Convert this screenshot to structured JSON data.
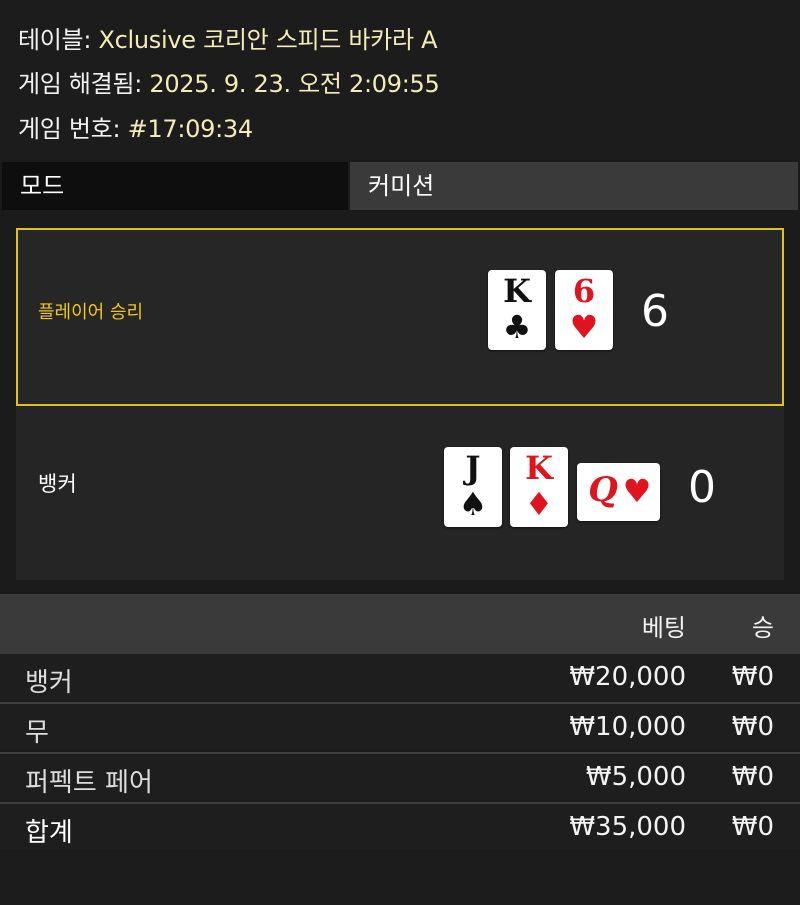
{
  "info": {
    "table_label": "테이블:",
    "table_value": "Xclusive 코리안 스피드 바카라 A",
    "resolved_label": "게임 해결됨:",
    "resolved_value": "2025. 9. 23. 오전 2:09:55",
    "game_no_label": "게임 번호:",
    "game_no_value": "#17:09:34"
  },
  "mode": {
    "mode_label": "모드",
    "commission_label": "커미션"
  },
  "result": {
    "player": {
      "label": "플레이어 승리",
      "score": "6",
      "cards": [
        {
          "rank": "K",
          "suit": "♣",
          "color": "black"
        },
        {
          "rank": "6",
          "suit": "♥",
          "color": "red"
        }
      ]
    },
    "banker": {
      "label": "뱅커",
      "score": "0",
      "cards": [
        {
          "rank": "J",
          "suit": "♠",
          "color": "black"
        },
        {
          "rank": "K",
          "suit": "♦",
          "color": "red"
        },
        {
          "rank": "Q",
          "suit": "♥",
          "color": "red"
        }
      ]
    }
  },
  "bets": {
    "headers": {
      "bet": "베팅",
      "win": "승"
    },
    "rows": [
      {
        "name": "뱅커",
        "bet": "₩20,000",
        "win": "₩0"
      },
      {
        "name": "무",
        "bet": "₩10,000",
        "win": "₩0"
      },
      {
        "name": "퍼펙트 페어",
        "bet": "₩5,000",
        "win": "₩0"
      }
    ],
    "total": {
      "name": "합계",
      "bet": "₩35,000",
      "win": "₩0"
    }
  },
  "colors": {
    "accent_yellow": "#e4c115",
    "card_red": "#e0141e",
    "value_text": "#f3ecb8"
  }
}
